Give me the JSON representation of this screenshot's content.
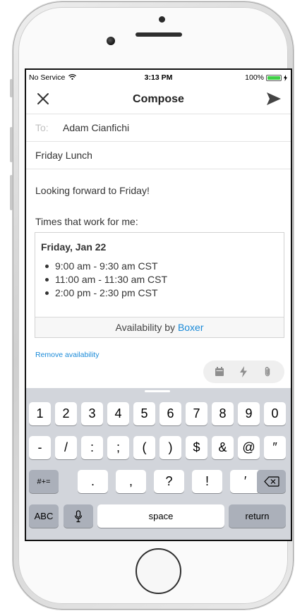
{
  "status_bar": {
    "carrier": "No Service",
    "time": "3:13 PM",
    "battery_percent": "100%",
    "battery_level": 1.0,
    "battery_color": "#3fd046"
  },
  "navbar": {
    "title": "Compose",
    "close_icon": "close-icon",
    "send_icon": "send-icon"
  },
  "compose": {
    "to_label": "To:",
    "to_value": "Adam Cianfichi",
    "subject": "Friday Lunch",
    "body_line1": "Looking forward to Friday!",
    "body_line2": "Times that work for me:"
  },
  "availability": {
    "date": "Friday, Jan 22",
    "slots": [
      "9:00 am - 9:30 am CST",
      "11:00 am - 11:30 am CST",
      "2:00 pm - 2:30 pm CST"
    ],
    "footer_prefix": "Availability by",
    "footer_brand": "Boxer",
    "brand_color": "#1a8ad8"
  },
  "remove_link": "Remove availability",
  "toolbar": {
    "icons": [
      "calendar-icon",
      "lightning-icon",
      "paperclip-icon"
    ]
  },
  "keyboard": {
    "row1": [
      "1",
      "2",
      "3",
      "4",
      "5",
      "6",
      "7",
      "8",
      "9",
      "0"
    ],
    "row2": [
      "-",
      "/",
      ":",
      ";",
      "(",
      ")",
      "$",
      "&",
      "@",
      "″"
    ],
    "row3": {
      "shift": "#+=",
      "keys": [
        ".",
        ",",
        "?",
        "!",
        "′"
      ],
      "delete_icon": "backspace-icon"
    },
    "row4": {
      "abc": "ABC",
      "mic_icon": "microphone-icon",
      "space": "space",
      "return": "return"
    }
  }
}
